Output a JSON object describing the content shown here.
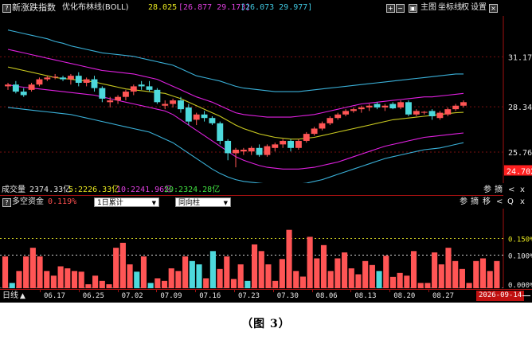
{
  "top": {
    "q": "?",
    "title": "新涨跌指数",
    "indicator_name": "优化布林线(BOLL)",
    "v1": "28.025",
    "v2": "[26.877 29.173]",
    "v3": "[26.073 29.977]",
    "btn_plus": "+",
    "btn_minus": "−",
    "btn_chart_icon": "▣",
    "btn_main": "主图",
    "btn_coord": "坐标线",
    "btn_rights": "权",
    "btn_settings": "设置",
    "btn_close": "×"
  },
  "price_axis": {
    "levels": [
      "31.174",
      "28.340",
      "25.764",
      "24.702"
    ],
    "current_price_color": "#ff2020"
  },
  "volume": {
    "label": "成交量",
    "total": "2374.33亿",
    "ma5": "5:2226.33亿",
    "ma10": "10:2241.96亿",
    "ma20": "20:2324.28亿",
    "btns": [
      "参",
      "摘",
      "<",
      "x"
    ]
  },
  "bottom_panel": {
    "q": "?",
    "title": "多空资金",
    "value": "0.119%",
    "select1": "1日累计",
    "select2": "同向柱",
    "btns": [
      "参",
      "摘",
      "移",
      "<",
      "Q",
      "x"
    ],
    "axis_levels": [
      "0.150%",
      "0.100%",
      "0.000%"
    ]
  },
  "xaxis": {
    "period": "日线",
    "period_arrow": "▲",
    "dates": [
      "06.17",
      "06.25",
      "07.02",
      "07.09",
      "07.16",
      "07.23",
      "07.30",
      "08.06",
      "08.13",
      "08.20",
      "08.27"
    ],
    "current_date": "2026-09-14"
  },
  "caption": "（图 3）",
  "colors": {
    "up": "#ff5555",
    "down": "#4dd9dc",
    "boll_mid": "#c8c820",
    "boll_inner": "#e020e0",
    "boll_outer": "#3ab0d8",
    "grid_red": "#a01010",
    "label_yellow": "#e8e820",
    "label_magenta": "#e040e0",
    "label_cyan": "#40c8e0"
  },
  "chart_data": [
    {
      "type": "candlestick",
      "title": "优化布林线(BOLL)",
      "ylim": [
        24.0,
        33.5
      ],
      "y_ticks": [
        31.174,
        28.34,
        25.764
      ],
      "current_price": 24.702,
      "candles": [
        {
          "o": 29.5,
          "h": 29.7,
          "l": 29.3,
          "c": 29.6
        },
        {
          "o": 29.6,
          "h": 29.8,
          "l": 29.1,
          "c": 29.2
        },
        {
          "o": 29.2,
          "h": 29.4,
          "l": 28.9,
          "c": 29.0
        },
        {
          "o": 29.3,
          "h": 29.7,
          "l": 29.2,
          "c": 29.6
        },
        {
          "o": 29.6,
          "h": 30.0,
          "l": 29.5,
          "c": 29.9
        },
        {
          "o": 29.9,
          "h": 30.1,
          "l": 29.8,
          "c": 30.0
        },
        {
          "o": 30.0,
          "h": 30.2,
          "l": 29.9,
          "c": 30.05
        },
        {
          "o": 30.0,
          "h": 30.1,
          "l": 29.8,
          "c": 29.9
        },
        {
          "o": 29.9,
          "h": 30.2,
          "l": 29.6,
          "c": 30.1
        },
        {
          "o": 30.1,
          "h": 30.3,
          "l": 29.5,
          "c": 29.7
        },
        {
          "o": 29.7,
          "h": 30.0,
          "l": 29.5,
          "c": 29.9
        },
        {
          "o": 29.9,
          "h": 30.1,
          "l": 29.2,
          "c": 29.4
        },
        {
          "o": 29.4,
          "h": 29.5,
          "l": 28.6,
          "c": 28.8
        },
        {
          "o": 28.6,
          "h": 28.9,
          "l": 28.3,
          "c": 28.7
        },
        {
          "o": 28.7,
          "h": 29.0,
          "l": 28.5,
          "c": 28.9
        },
        {
          "o": 28.9,
          "h": 29.3,
          "l": 28.7,
          "c": 29.2
        },
        {
          "o": 29.2,
          "h": 29.6,
          "l": 29.0,
          "c": 29.5
        },
        {
          "o": 29.6,
          "h": 29.8,
          "l": 29.3,
          "c": 29.5
        },
        {
          "o": 29.5,
          "h": 29.8,
          "l": 29.2,
          "c": 29.3
        },
        {
          "o": 29.3,
          "h": 29.4,
          "l": 28.5,
          "c": 28.6
        },
        {
          "o": 28.4,
          "h": 28.7,
          "l": 28.2,
          "c": 28.5
        },
        {
          "o": 28.5,
          "h": 28.8,
          "l": 28.3,
          "c": 28.7
        },
        {
          "o": 28.7,
          "h": 28.9,
          "l": 28.0,
          "c": 28.2
        },
        {
          "o": 28.3,
          "h": 28.5,
          "l": 27.3,
          "c": 27.5
        },
        {
          "o": 27.6,
          "h": 28.0,
          "l": 27.3,
          "c": 27.9
        },
        {
          "o": 27.9,
          "h": 28.1,
          "l": 27.5,
          "c": 27.7
        },
        {
          "o": 27.7,
          "h": 27.8,
          "l": 27.3,
          "c": 27.4
        },
        {
          "o": 27.4,
          "h": 27.5,
          "l": 26.2,
          "c": 26.4
        },
        {
          "o": 26.4,
          "h": 26.5,
          "l": 25.3,
          "c": 25.7
        },
        {
          "o": 25.7,
          "h": 26.0,
          "l": 24.9,
          "c": 25.9
        },
        {
          "o": 25.8,
          "h": 26.0,
          "l": 25.6,
          "c": 25.9
        },
        {
          "o": 25.8,
          "h": 26.1,
          "l": 25.6,
          "c": 26.0
        },
        {
          "o": 26.0,
          "h": 26.2,
          "l": 25.5,
          "c": 25.6
        },
        {
          "o": 25.6,
          "h": 26.2,
          "l": 25.5,
          "c": 26.1
        },
        {
          "o": 26.0,
          "h": 26.3,
          "l": 25.8,
          "c": 26.2
        },
        {
          "o": 26.2,
          "h": 26.5,
          "l": 26.0,
          "c": 26.4
        },
        {
          "o": 26.4,
          "h": 26.5,
          "l": 25.8,
          "c": 26.0
        },
        {
          "o": 26.0,
          "h": 26.5,
          "l": 25.9,
          "c": 26.4
        },
        {
          "o": 26.4,
          "h": 26.9,
          "l": 26.3,
          "c": 26.8
        },
        {
          "o": 26.8,
          "h": 27.2,
          "l": 26.7,
          "c": 27.1
        },
        {
          "o": 27.1,
          "h": 27.5,
          "l": 27.0,
          "c": 27.4
        },
        {
          "o": 27.4,
          "h": 27.8,
          "l": 27.3,
          "c": 27.7
        },
        {
          "o": 27.7,
          "h": 28.0,
          "l": 27.6,
          "c": 27.9
        },
        {
          "o": 27.9,
          "h": 28.2,
          "l": 27.8,
          "c": 28.1
        },
        {
          "o": 28.1,
          "h": 28.3,
          "l": 28.0,
          "c": 28.2
        },
        {
          "o": 28.2,
          "h": 28.4,
          "l": 28.0,
          "c": 28.3
        },
        {
          "o": 28.3,
          "h": 28.5,
          "l": 28.1,
          "c": 28.4
        },
        {
          "o": 28.5,
          "h": 28.6,
          "l": 28.2,
          "c": 28.3
        },
        {
          "o": 28.3,
          "h": 28.5,
          "l": 28.1,
          "c": 28.4
        },
        {
          "o": 28.5,
          "h": 28.6,
          "l": 28.2,
          "c": 28.25
        },
        {
          "o": 28.3,
          "h": 28.7,
          "l": 28.2,
          "c": 28.6
        },
        {
          "o": 28.6,
          "h": 28.7,
          "l": 27.8,
          "c": 27.9
        },
        {
          "o": 27.9,
          "h": 28.2,
          "l": 27.8,
          "c": 28.1
        },
        {
          "o": 28.0,
          "h": 28.1,
          "l": 27.9,
          "c": 28.05
        },
        {
          "o": 28.1,
          "h": 28.2,
          "l": 27.6,
          "c": 27.8
        },
        {
          "o": 27.7,
          "h": 28.1,
          "l": 27.6,
          "c": 28.0
        },
        {
          "o": 27.9,
          "h": 28.3,
          "l": 27.8,
          "c": 28.2
        },
        {
          "o": 28.2,
          "h": 28.5,
          "l": 28.1,
          "c": 28.4
        },
        {
          "o": 28.4,
          "h": 28.7,
          "l": 28.3,
          "c": 28.6
        }
      ],
      "boll": {
        "upper_outer": [
          32.7,
          32.6,
          32.5,
          32.4,
          32.3,
          32.2,
          32.05,
          31.95,
          31.8,
          31.7,
          31.6,
          31.5,
          31.4,
          31.35,
          31.3,
          31.25,
          31.2,
          31.1,
          31.0,
          30.9,
          30.8,
          30.7,
          30.5,
          30.3,
          30.1,
          30.0,
          29.9,
          29.8,
          29.65,
          29.5,
          29.4,
          29.35,
          29.3,
          29.25,
          29.2,
          29.2,
          29.2,
          29.2,
          29.25,
          29.3,
          29.35,
          29.4,
          29.45,
          29.5,
          29.55,
          29.6,
          29.65,
          29.7,
          29.75,
          29.8,
          29.85,
          29.9,
          29.95,
          30.0,
          30.05,
          30.1,
          30.15,
          30.2,
          30.2
        ],
        "upper_inner": [
          31.6,
          31.5,
          31.4,
          31.3,
          31.2,
          31.1,
          31.0,
          30.9,
          30.8,
          30.7,
          30.6,
          30.5,
          30.4,
          30.35,
          30.3,
          30.25,
          30.2,
          30.1,
          30.0,
          29.9,
          29.7,
          29.5,
          29.3,
          29.1,
          28.9,
          28.75,
          28.6,
          28.4,
          28.2,
          28.0,
          27.9,
          27.85,
          27.8,
          27.75,
          27.75,
          27.75,
          27.75,
          27.8,
          27.85,
          27.9,
          28.0,
          28.1,
          28.2,
          28.3,
          28.4,
          28.5,
          28.55,
          28.6,
          28.65,
          28.7,
          28.75,
          28.8,
          28.85,
          28.9,
          28.9,
          28.95,
          29.0,
          29.05,
          29.1
        ],
        "mid": [
          30.6,
          30.5,
          30.4,
          30.3,
          30.2,
          30.1,
          30.0,
          29.95,
          29.9,
          29.85,
          29.8,
          29.75,
          29.65,
          29.55,
          29.45,
          29.35,
          29.3,
          29.25,
          29.2,
          29.15,
          29.1,
          28.95,
          28.8,
          28.6,
          28.4,
          28.2,
          28.0,
          27.8,
          27.55,
          27.3,
          27.1,
          26.95,
          26.8,
          26.7,
          26.6,
          26.55,
          26.5,
          26.5,
          26.55,
          26.6,
          26.7,
          26.8,
          26.9,
          27.0,
          27.1,
          27.2,
          27.3,
          27.4,
          27.5,
          27.6,
          27.65,
          27.7,
          27.75,
          27.8,
          27.85,
          27.9,
          27.95,
          28.0,
          28.02
        ],
        "lower_inner": [
          29.6,
          29.5,
          29.45,
          29.4,
          29.35,
          29.3,
          29.25,
          29.2,
          29.15,
          29.1,
          29.05,
          29.0,
          28.9,
          28.8,
          28.7,
          28.6,
          28.5,
          28.4,
          28.3,
          28.2,
          28.1,
          27.9,
          27.6,
          27.3,
          27.0,
          26.7,
          26.4,
          26.1,
          25.8,
          25.5,
          25.3,
          25.15,
          25.0,
          24.9,
          24.85,
          24.8,
          24.8,
          24.8,
          24.85,
          24.9,
          25.0,
          25.1,
          25.2,
          25.35,
          25.5,
          25.65,
          25.8,
          25.95,
          26.1,
          26.2,
          26.3,
          26.4,
          26.5,
          26.6,
          26.65,
          26.7,
          26.75,
          26.8,
          26.85
        ],
        "lower_outer": [
          28.3,
          28.25,
          28.2,
          28.15,
          28.1,
          28.05,
          28.0,
          27.95,
          27.9,
          27.8,
          27.7,
          27.6,
          27.5,
          27.4,
          27.3,
          27.2,
          27.1,
          27.0,
          26.9,
          26.7,
          26.5,
          26.3,
          26.0,
          25.7,
          25.4,
          25.1,
          24.8,
          24.55,
          24.35,
          24.2,
          24.1,
          24.05,
          24.0,
          23.95,
          23.9,
          23.9,
          23.9,
          23.95,
          24.0,
          24.1,
          24.2,
          24.35,
          24.5,
          24.65,
          24.8,
          24.95,
          25.1,
          25.25,
          25.4,
          25.5,
          25.6,
          25.7,
          25.8,
          25.9,
          25.95,
          26.0,
          26.1,
          26.2,
          26.3
        ]
      }
    },
    {
      "type": "bar",
      "title": "多空资金",
      "ylabel": "%",
      "ylim": [
        0,
        0.24
      ],
      "y_ticks": [
        0.15,
        0.1,
        0.0
      ],
      "values": [
        0.096,
        0.016,
        0.052,
        0.096,
        0.122,
        0.096,
        0.052,
        0.038,
        0.066,
        0.06,
        0.052,
        0.05,
        0.012,
        0.038,
        0.022,
        0.012,
        0.122,
        0.137,
        0.072,
        0.05,
        0.096,
        0.016,
        0.03,
        0.022,
        0.06,
        0.052,
        0.096,
        0.082,
        0.072,
        0.03,
        0.112,
        0.058,
        0.096,
        0.028,
        0.072,
        0.022,
        0.132,
        0.112,
        0.072,
        0.022,
        0.088,
        0.176,
        0.052,
        0.035,
        0.155,
        0.09,
        0.13,
        0.052,
        0.09,
        0.108,
        0.06,
        0.042,
        0.082,
        0.07,
        0.052,
        0.098,
        0.034,
        0.046,
        0.038,
        0.112,
        0.016,
        0.016,
        0.108,
        0.072,
        0.122,
        0.082,
        0.058,
        0.016,
        0.082,
        0.09,
        0.052,
        0.082
      ],
      "directions": [
        "u",
        "d",
        "u",
        "u",
        "u",
        "u",
        "u",
        "u",
        "u",
        "u",
        "u",
        "u",
        "u",
        "u",
        "u",
        "u",
        "u",
        "u",
        "u",
        "d",
        "u",
        "d",
        "u",
        "u",
        "u",
        "u",
        "u",
        "d",
        "d",
        "u",
        "d",
        "u",
        "u",
        "u",
        "u",
        "d",
        "u",
        "u",
        "u",
        "u",
        "u",
        "u",
        "u",
        "u",
        "u",
        "u",
        "u",
        "u",
        "u",
        "u",
        "u",
        "u",
        "u",
        "u",
        "d",
        "u",
        "u",
        "u",
        "u",
        "u",
        "u",
        "u",
        "u",
        "u",
        "u",
        "u",
        "u",
        "u",
        "u",
        "u",
        "u",
        "u"
      ]
    }
  ]
}
